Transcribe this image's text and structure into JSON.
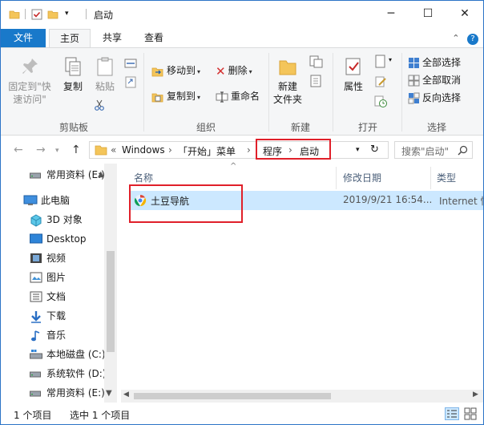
{
  "window": {
    "title": "启动",
    "controls": {
      "minimize": "─",
      "maximize": "☐",
      "close": "✕"
    }
  },
  "ribbon_tabs": [
    "文件",
    "主页",
    "共享",
    "查看"
  ],
  "ribbon": {
    "clipboard": {
      "pin_line1": "固定到\"快",
      "pin_line2": "速访问\"",
      "copy": "复制",
      "paste": "粘贴",
      "group": "剪贴板"
    },
    "organize": {
      "move_to": "移动到",
      "copy_to": "复制到",
      "delete": "删除",
      "rename": "重命名",
      "group": "组织"
    },
    "new": {
      "new_folder_line1": "新建",
      "new_folder_line2": "文件夹",
      "group": "新建"
    },
    "open": {
      "properties": "属性",
      "group": "打开"
    },
    "select": {
      "select_all": "全部选择",
      "select_none": "全部取消",
      "invert": "反向选择",
      "group": "选择"
    }
  },
  "address": {
    "overflow": "«",
    "crumbs": [
      "Windows",
      "「开始」菜单",
      "程序",
      "启动"
    ],
    "separator": "›"
  },
  "search": {
    "placeholder": "搜索\"启动\""
  },
  "nav_pane": [
    {
      "label": "常用资料 (E:)",
      "icon": "drive-icon"
    },
    {
      "label": "此电脑",
      "icon": "computer-icon"
    },
    {
      "label": "3D 对象",
      "icon": "3d-objects-icon"
    },
    {
      "label": "Desktop",
      "icon": "desktop-icon"
    },
    {
      "label": "视频",
      "icon": "video-icon"
    },
    {
      "label": "图片",
      "icon": "pictures-icon"
    },
    {
      "label": "文档",
      "icon": "documents-icon"
    },
    {
      "label": "下载",
      "icon": "download-icon"
    },
    {
      "label": "音乐",
      "icon": "music-icon"
    },
    {
      "label": "本地磁盘 (C:)",
      "icon": "windows-drive-icon"
    },
    {
      "label": "系统软件 (D:)",
      "icon": "drive-icon"
    },
    {
      "label": "常用资料 (E:)",
      "icon": "drive-icon"
    }
  ],
  "columns": {
    "name": "名称",
    "modified": "修改日期",
    "type": "类型"
  },
  "files": [
    {
      "name": "土豆导航",
      "modified": "2019/9/21 16:54...",
      "type": "Internet 快"
    }
  ],
  "status": {
    "item_count": "1 个项目",
    "selected": "选中 1 个项目"
  },
  "colors": {
    "accent": "#1979ca",
    "selection": "#cce8ff",
    "highlight_box": "#e0202a",
    "folder": "#f4c55a"
  }
}
